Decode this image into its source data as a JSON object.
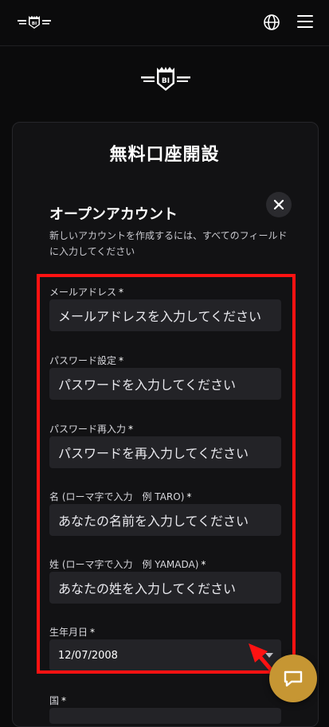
{
  "header": {
    "logo_icon": "bi-crest-logo",
    "globe_icon": "globe-icon",
    "menu_icon": "hamburger-icon",
    "logo_text": "BI"
  },
  "card": {
    "title": "無料口座開設",
    "section_title": "オープンアカウント",
    "section_desc": "新しいアカウントを作成するには、すべてのフィールドに入力してください",
    "close_icon": "close-icon"
  },
  "form": {
    "email_label": "メールアドレス",
    "email_placeholder": "メールアドレスを入力してください",
    "password_label": "パスワード設定",
    "password_placeholder": "パスワードを入力してください",
    "password_confirm_label": "パスワード再入力",
    "password_confirm_placeholder": "パスワードを再入力してください",
    "first_name_label": "名 (ローマ字で入力　例 TARO)",
    "first_name_placeholder": "あなたの名前を入力してください",
    "last_name_label": "姓 (ローマ字で入力　例 YAMADA)",
    "last_name_placeholder": "あなたの姓を入力してください",
    "dob_label": "生年月日",
    "dob_value": "12/07/2008",
    "country_label": "国",
    "required_mark": "*"
  },
  "colors": {
    "background": "#0b0b0c",
    "card": "#121214",
    "field": "#232327",
    "highlight": "#ff1212",
    "chat_button": "#c69633"
  },
  "chat": {
    "icon": "chat-bubble-icon"
  }
}
